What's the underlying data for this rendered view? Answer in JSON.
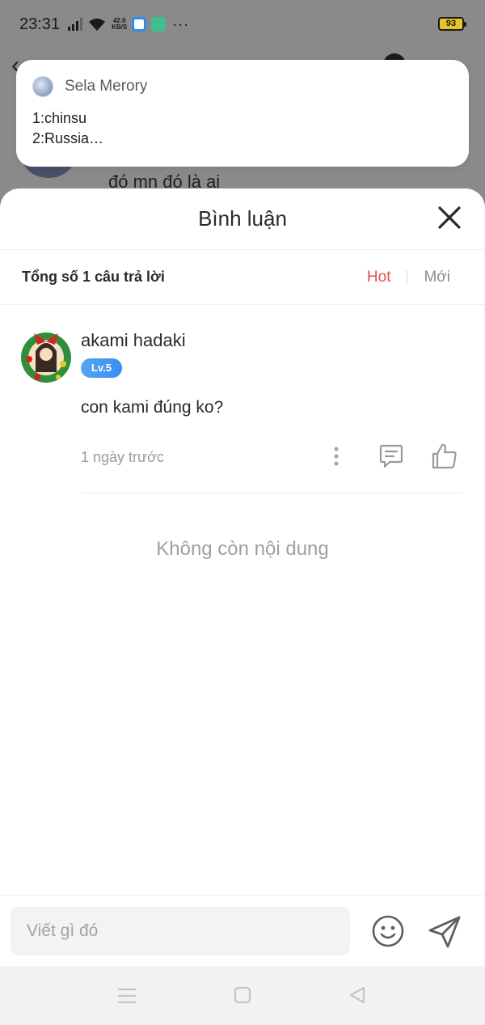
{
  "status_bar": {
    "time": "23:31",
    "net_speed_value": "42.0",
    "net_speed_unit": "KB/S",
    "overflow": "···",
    "battery": "93"
  },
  "background_app": {
    "comment_snippet": "đó mn đó là ai"
  },
  "notification": {
    "sender": "Sela Merory",
    "lines": [
      "1:chinsu",
      "2:Russia…"
    ]
  },
  "sheet": {
    "title": "Bình luận",
    "close_icon": "close-icon"
  },
  "sort_bar": {
    "total": "Tổng số 1 câu trả lời",
    "hot_label": "Hot",
    "new_label": "Mới",
    "active_color": "#EA4C4C"
  },
  "comments": [
    {
      "author": "akami hadaki",
      "level": "Lv.5",
      "text": "con kami đúng ko?",
      "time": "1 ngày trước"
    }
  ],
  "empty_message": "Không còn nội dung",
  "input": {
    "placeholder": "Viết gì đó",
    "value": ""
  },
  "colors": {
    "accent_red": "#EA4C4C",
    "level_blue": "#3B8EF0"
  }
}
